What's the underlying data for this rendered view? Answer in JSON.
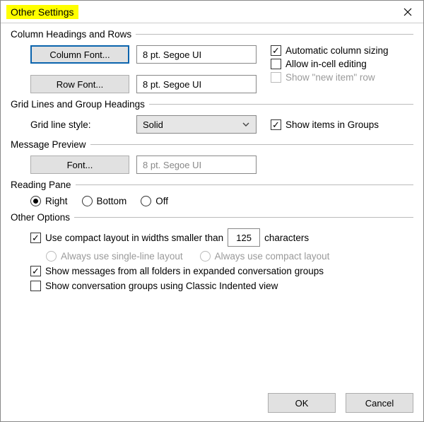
{
  "window": {
    "title": "Other Settings"
  },
  "sections": {
    "column_headings": {
      "title": "Column Headings and Rows",
      "column_font_btn": "Column Font...",
      "column_font_value": "8 pt. Segoe UI",
      "row_font_btn": "Row Font...",
      "row_font_value": "8 pt. Segoe UI",
      "auto_sizing": {
        "label": "Automatic column sizing",
        "checked": true
      },
      "incell_edit": {
        "label": "Allow in-cell editing",
        "checked": false
      },
      "show_new_item": {
        "label": "Show \"new item\" row",
        "checked": false,
        "disabled": true
      }
    },
    "grid": {
      "title": "Grid Lines and Group Headings",
      "style_label": "Grid line style:",
      "style_value": "Solid",
      "show_groups": {
        "label": "Show items in Groups",
        "checked": true
      }
    },
    "preview": {
      "title": "Message Preview",
      "font_btn": "Font...",
      "font_value": "8 pt. Segoe UI"
    },
    "reading_pane": {
      "title": "Reading Pane",
      "options": {
        "right": "Right",
        "bottom": "Bottom",
        "off": "Off"
      },
      "selected": "right"
    },
    "other": {
      "title": "Other Options",
      "compact": {
        "label_before": "Use compact layout in widths smaller than",
        "value": "125",
        "label_after": "characters",
        "checked": true
      },
      "single_line": {
        "label": "Always use single-line layout",
        "selected": false,
        "disabled": true
      },
      "compact_always": {
        "label": "Always use compact layout",
        "selected": false,
        "disabled": true
      },
      "expanded_conv": {
        "label": "Show messages from all folders in expanded conversation groups",
        "checked": true
      },
      "classic_indent": {
        "label": "Show conversation groups using Classic Indented view",
        "checked": false
      }
    }
  },
  "footer": {
    "ok": "OK",
    "cancel": "Cancel"
  }
}
